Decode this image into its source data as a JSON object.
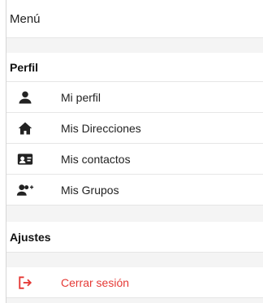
{
  "menu": {
    "title": "Menú"
  },
  "perfil": {
    "title": "Perfil",
    "items": [
      {
        "label": "Mi perfil",
        "icon": "person-icon"
      },
      {
        "label": "Mis Direcciones",
        "icon": "home-icon"
      },
      {
        "label": "Mis contactos",
        "icon": "contact-card-icon"
      },
      {
        "label": "Mis Grupos",
        "icon": "group-add-icon"
      }
    ]
  },
  "ajustes": {
    "title": "Ajustes"
  },
  "logout": {
    "label": "Cerrar sesión",
    "icon": "logout-icon",
    "color": "#e53935"
  }
}
